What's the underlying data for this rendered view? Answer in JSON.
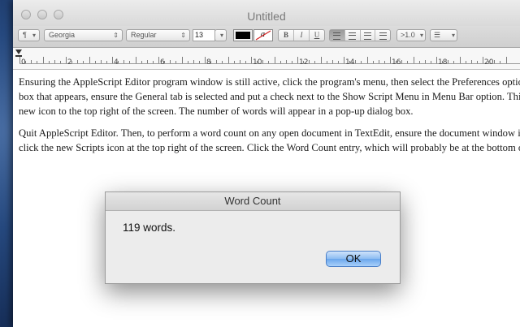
{
  "window": {
    "title": "Untitled"
  },
  "toolbar": {
    "paragraph_label": "¶",
    "font_family": "Georgia",
    "font_style": "Regular",
    "font_size": "13",
    "bold": "B",
    "italic": "I",
    "underline": "U",
    "spacing": ">1.0",
    "text_color": "#000000",
    "highlight_glyph": "a"
  },
  "ruler": {
    "labels": [
      "0",
      "2",
      "4",
      "6",
      "8",
      "10",
      "12",
      "14",
      "16",
      "18",
      "20"
    ]
  },
  "document": {
    "paragraphs": [
      "Ensuring the AppleScript Editor program window is still active, click the program's menu, then select the Preferences option. In the dialog",
      "box that appears, ensure the General tab is selected and put a check next to the Show Script Menu in Menu Bar option. This will add a",
      "new icon to the top right of the screen. The number of words will appear in a pop-up dialog box.",
      "Quit AppleScript Editor. Then, to perform a word count on any open document in TextEdit, ensure the document window is active and",
      "click the new Scripts icon at the top right of the screen. Click the Word Count entry, which will probably be at the bottom of the list."
    ]
  },
  "dialog": {
    "title": "Word Count",
    "message": "119 words.",
    "ok_label": "OK"
  },
  "colors": {
    "selected_button": "#6aa6ec",
    "desktop": "#26497f"
  }
}
